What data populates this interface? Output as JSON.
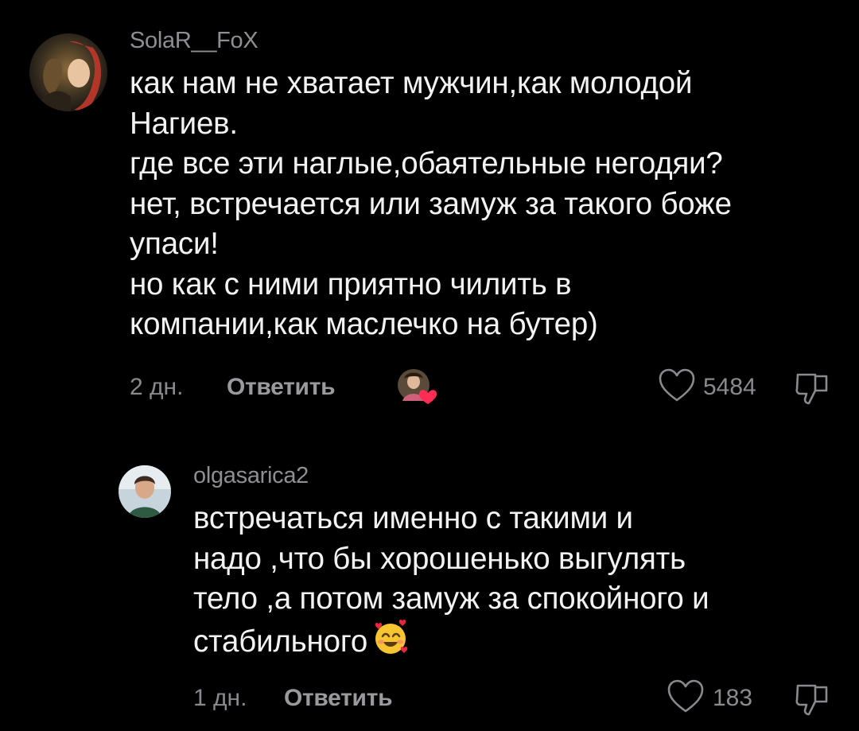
{
  "comments": [
    {
      "username": "SolaR__FoX",
      "lines": [
        "как нам не хватает мужчин,как молодой",
        "Нагиев.",
        "где все эти наглые,обаятельные негодяи?",
        "нет, встречается или замуж за такого боже",
        "упаси!",
        "но как с ними приятно чилить в",
        "компании,как маслечко на бутер)"
      ],
      "time": "2 дн.",
      "reply_label": "Ответить",
      "likes": "5484",
      "creator_liked": true
    },
    {
      "username": "olgasarica2",
      "lines": [
        "встречаться именно с такими и",
        "надо ,что бы хорошенько выгулять",
        "тело ,а потом замуж за спокойного и",
        "стабильного"
      ],
      "emoji": "smiling-face-with-hearts",
      "time": "1 дн.",
      "reply_label": "Ответить",
      "likes": "183"
    }
  ],
  "icons": {
    "like": "heart-outline-icon",
    "dislike": "thumbs-down-icon"
  },
  "colors": {
    "background": "#000000",
    "text": "#f2f2f2",
    "secondary": "#8e8e93",
    "heart_badge": "#ff2d55"
  }
}
